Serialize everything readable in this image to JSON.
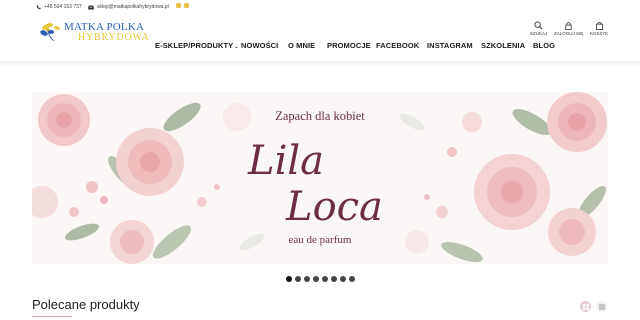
{
  "topbar": {
    "phone": "+48 504 153 737",
    "email": "sklep@matkapolkahybrydowa.pl",
    "social_icons": [
      "facebook-icon",
      "instagram-icon"
    ]
  },
  "logo": {
    "line1": "MATKA POLKA",
    "line2": "HYBRYDOWA"
  },
  "nav": {
    "items": [
      {
        "label": "E-SKLEP/PRODUKTY",
        "has_dropdown": true
      },
      {
        "label": "NOWOŚCI"
      },
      {
        "label": "O MNIE"
      },
      {
        "label": "PROMOCJE"
      },
      {
        "label": "FACEBOOK"
      },
      {
        "label": "INSTAGRAM"
      },
      {
        "label": "SZKOLENIA"
      },
      {
        "label": "BLOG"
      }
    ]
  },
  "header_icons": {
    "search": "SZUKAJ",
    "login": "ZALOGUJ SIĘ",
    "cart": "KOSZYK"
  },
  "banner": {
    "title": "Zapach dla kobiet",
    "script_line1": "Lila",
    "script_line2": "Loca",
    "subtitle": "eau de parfum"
  },
  "slider": {
    "total": 8,
    "active": 1
  },
  "section": {
    "title": "Polecane produkty"
  },
  "colors": {
    "brand_blue": "#2b5fb3",
    "brand_yellow": "#e7c53a",
    "banner_text": "#6e2d46",
    "accent_pink": "#e7cdd8"
  }
}
